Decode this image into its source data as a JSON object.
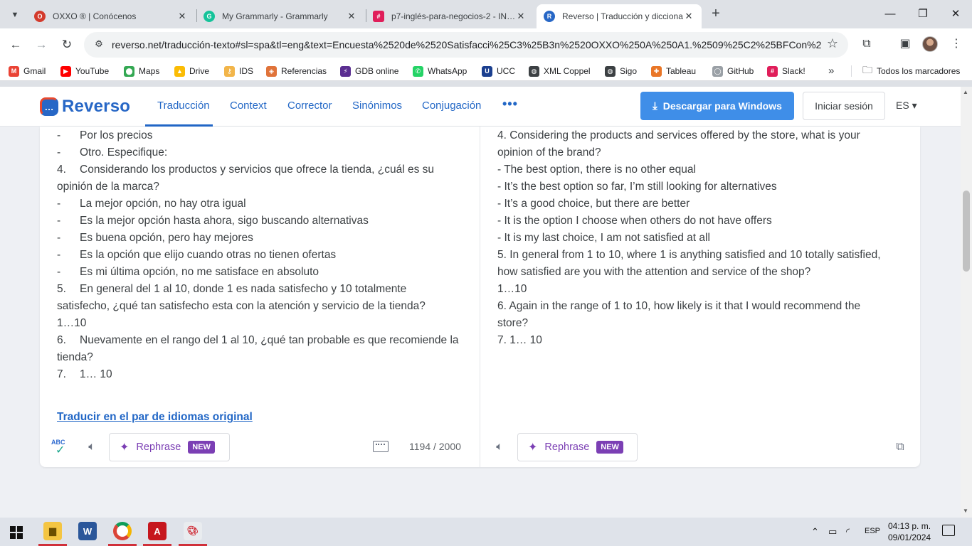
{
  "browser": {
    "tabs": [
      {
        "title": "OXXO ® | Conócenos",
        "favicon_color": "#d33a2c",
        "favicon_text": "O",
        "close": "✕"
      },
      {
        "title": "My Grammarly - Grammarly",
        "favicon_color": "#15c39a",
        "favicon_text": "G",
        "close": "✕"
      },
      {
        "title": "p7-inglés-para-negocios-2 - IN…",
        "favicon_color": "#e01e5a",
        "favicon_text": "#",
        "close": "✕"
      },
      {
        "title": "Reverso | Traducción y dicciona…",
        "favicon_color": "#2767c6",
        "favicon_text": "R",
        "close": "✕"
      }
    ],
    "url": "reverso.net/traducción-texto#sl=spa&tl=eng&text=Encuesta%2520de%2520Satisfacci%25C3%25B3n%2520OXXO%250A%250A1.%2509%25C2%25BFCon%252…",
    "bookmarks": [
      {
        "label": "Gmail",
        "color": "#ea4335",
        "glyph": "M"
      },
      {
        "label": "YouTube",
        "color": "#ff0000",
        "glyph": "▶"
      },
      {
        "label": "Maps",
        "color": "#34a853",
        "glyph": "⬤"
      },
      {
        "label": "Drive",
        "color": "#fbbc04",
        "glyph": "▲"
      },
      {
        "label": "IDS",
        "color": "#f2b54a",
        "glyph": "⚷"
      },
      {
        "label": "Referencias",
        "color": "#e0733a",
        "glyph": "◈"
      },
      {
        "label": "GDB online",
        "color": "#5b2e91",
        "glyph": "⚡"
      },
      {
        "label": "WhatsApp",
        "color": "#25d366",
        "glyph": "✆"
      },
      {
        "label": "UCC",
        "color": "#1b3f8f",
        "glyph": "U"
      },
      {
        "label": "XML Coppel",
        "color": "#3c4043",
        "glyph": "◍"
      },
      {
        "label": "Sigo",
        "color": "#3c4043",
        "glyph": "◍"
      },
      {
        "label": "Tableau",
        "color": "#e97627",
        "glyph": "✚"
      },
      {
        "label": "GitHub",
        "color": "#9aa0a6",
        "glyph": "◯"
      },
      {
        "label": "Slack!",
        "color": "#e01e5a",
        "glyph": "#"
      }
    ],
    "all_bookmarks": "Todos los marcadores"
  },
  "site": {
    "logo": "Reverso",
    "nav": [
      "Traducción",
      "Context",
      "Corrector",
      "Sinónimos",
      "Conjugación"
    ],
    "more": "•••",
    "download": "Descargar para Windows",
    "login": "Iniciar sesión",
    "lang": "ES ▾"
  },
  "source": {
    "lines": [
      {
        "dash": "-",
        "text": "Por los precios"
      },
      {
        "dash": "-",
        "text": "Otro. Especifique:"
      },
      {
        "dash": "4.",
        "text": "Considerando los productos y servicios que ofrece la tienda, ¿cuál es su"
      },
      {
        "dash": "",
        "text": "opinión de la marca?"
      },
      {
        "dash": "-",
        "text": "La mejor opción, no hay otra igual"
      },
      {
        "dash": "-",
        "text": "Es la mejor opción hasta ahora, sigo buscando alternativas"
      },
      {
        "dash": "-",
        "text": "Es buena opción, pero hay mejores"
      },
      {
        "dash": "-",
        "text": "Es la opción que elijo cuando otras no tienen ofertas"
      },
      {
        "dash": "-",
        "text": "Es mi última opción, no me satisface en absoluto"
      },
      {
        "dash": "5.",
        "text": "En general del 1 al 10, donde 1 es nada satisfecho y 10 totalmente"
      },
      {
        "dash": "",
        "text": "satisfecho, ¿qué tan satisfecho esta con la atención y servicio de la tienda?"
      },
      {
        "dash": "",
        "text": "1…10"
      },
      {
        "dash": "6.",
        "text": "Nuevamente en el rango del 1 al 10, ¿qué tan probable es que recomiende la"
      },
      {
        "dash": "",
        "text": "tienda?"
      },
      {
        "dash": "7.",
        "text": "1… 10"
      }
    ],
    "original_pair_link": "Traducir en el par de idiomas original",
    "char_count": "1194 / 2000",
    "spell_label": "ABC"
  },
  "target": {
    "lines": [
      "4.  Considering the products and services offered by the store, what is your",
      "opinion of the brand?",
      "-  The best option, there is no other equal",
      "-  It’s the best option so far, I’m still looking for alternatives",
      "-  It’s a good choice, but there are better",
      "-  It is the option I choose when others do not have offers",
      "-  It is my last choice, I am not satisfied at all",
      "5.  In general from 1 to 10, where 1 is anything satisfied and 10 totally satisfied,",
      "how satisfied are you with the attention and service of the shop?",
      "1…10",
      "6.  Again in the range of 1 to 10, how likely is it that I would recommend the",
      "store?",
      "7.  1… 10"
    ]
  },
  "rephrase": {
    "label": "Rephrase",
    "badge": "NEW"
  },
  "taskbar": {
    "tray_lang": "ESP",
    "time": "04:13 p. m.",
    "date": "09/01/2024"
  }
}
